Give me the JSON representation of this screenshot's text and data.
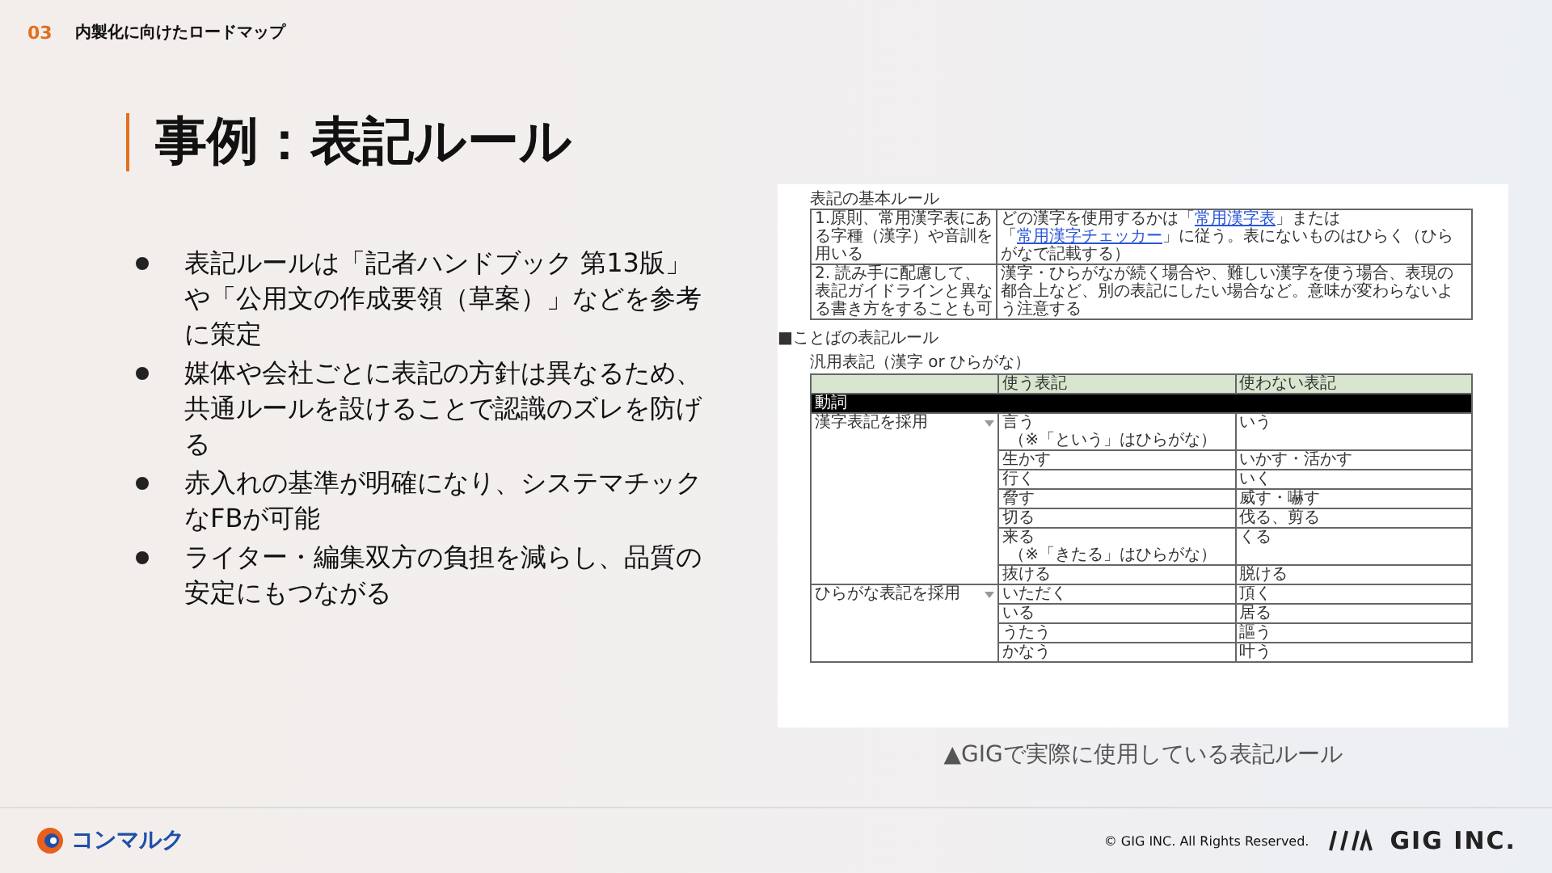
{
  "header": {
    "section_number": "03",
    "section_title": "内製化に向けたロードマップ"
  },
  "title": "事例：表記ルール",
  "bullets": [
    "表記ルールは「記者ハンドブック 第13版」や「公用文の作成要領（草案）」などを参考に策定",
    "媒体や会社ごとに表記の方針は異なるため、共通ルールを設けることで認識のズレを防げる",
    "赤入れの基準が明確になり、システマチックなFBが可能",
    "ライター・編集双方の負担を減らし、品質の安定にもつながる"
  ],
  "document": {
    "basic_title": "表記の基本ルール",
    "basic_rows": [
      {
        "rule": "1.原則、常用漢字表にある字種（漢字）や音訓を用いる",
        "detail": [
          {
            "kind": "text",
            "text": "どの漢字を使用するかは「"
          },
          {
            "kind": "link",
            "text": "常用漢字表"
          },
          {
            "kind": "text",
            "text": "」または「"
          },
          {
            "kind": "link",
            "text": "常用漢字チェッカー"
          },
          {
            "kind": "text",
            "text": "」に従う。表にないものはひらく（ひらがなで記載する）"
          }
        ]
      },
      {
        "rule": "2. 読み手に配慮して、表記ガイドラインと異なる書き方をすることも可",
        "detail": [
          {
            "kind": "text",
            "text": "漢字・ひらがなが続く場合や、難しい漢字を使う場合、表現の都合上など、別の表記にしたい場合など。意味が変わらないよう注意する"
          }
        ]
      }
    ],
    "word_heading": "■ことばの表記ルール",
    "generic_title": "汎用表記（漢字 or ひらがな）",
    "columns": [
      "使う表記",
      "使わない表記"
    ],
    "section": "動詞",
    "groups": [
      {
        "label": "漢字表記を採用",
        "rows": [
          {
            "use": "言う",
            "note": "（※「という」はひらがな）",
            "avoid": "いう"
          },
          {
            "use": "生かす",
            "avoid": "いかす・活かす"
          },
          {
            "use": "行く",
            "avoid": "いく"
          },
          {
            "use": "脅す",
            "avoid": "威す・嚇す"
          },
          {
            "use": "切る",
            "avoid": "伐る、剪る"
          },
          {
            "use": "来る",
            "note": "（※「きたる」はひらがな）",
            "avoid": "くる"
          },
          {
            "use": "抜ける",
            "avoid": "脱ける"
          }
        ]
      },
      {
        "label": "ひらがな表記を採用",
        "rows": [
          {
            "use": "いただく",
            "avoid": "頂く"
          },
          {
            "use": "いる",
            "avoid": "居る"
          },
          {
            "use": "うたう",
            "avoid": "謳う"
          },
          {
            "use": "かなう",
            "avoid": "叶う"
          }
        ]
      }
    ]
  },
  "caption": "▲GIGで実際に使用している表記ルール",
  "footer": {
    "brand": "コンマルク",
    "copyright": "© GIG INC. All Rights Reserved.",
    "company": "GIG INC."
  }
}
